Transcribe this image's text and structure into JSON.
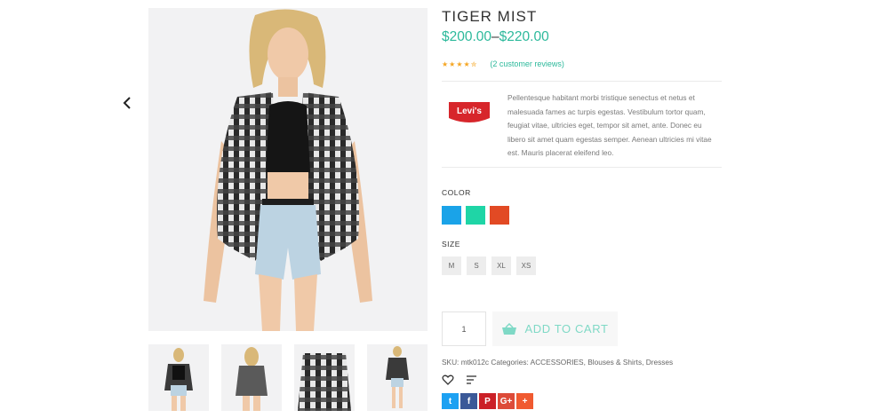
{
  "product": {
    "title": "TIGER MIST",
    "price_min": "$200.00",
    "price_sep": "–",
    "price_max": "$220.00",
    "rating": 4.5,
    "stars_text": "★★★★✮",
    "reviews_text": "(2 customer reviews)",
    "brand_logo_text": "Levi's",
    "description": "Pellentesque habitant morbi tristique senectus et netus et malesuada fames ac turpis egestas. Vestibulum tortor quam, feugiat vitae, ultricies eget, tempor sit amet, ante. Donec eu libero sit amet quam egestas semper. Aenean ultricies mi vitae est. Mauris placerat eleifend leo."
  },
  "color": {
    "label": "COLOR",
    "options": [
      {
        "name": "blue",
        "hex": "#1aa3e8"
      },
      {
        "name": "green",
        "hex": "#1fd5a6"
      },
      {
        "name": "red",
        "hex": "#e24a24"
      }
    ]
  },
  "size": {
    "label": "SIZE",
    "options": [
      "M",
      "S",
      "XL",
      "XS"
    ]
  },
  "cart": {
    "quantity": "1",
    "add_label": "ADD TO CART"
  },
  "meta": {
    "sku_label": "SKU:",
    "sku": "mtk012c",
    "categories_label": "Categories:",
    "categories": [
      "ACCESSORIES",
      "Blouses & Shirts",
      "Dresses"
    ]
  },
  "social": [
    {
      "name": "twitter",
      "glyph": "t",
      "color": "#1da1f2"
    },
    {
      "name": "facebook",
      "glyph": "f",
      "color": "#3b5998"
    },
    {
      "name": "pinterest",
      "glyph": "P",
      "color": "#cb2027"
    },
    {
      "name": "google-plus",
      "glyph": "G+",
      "color": "#dd4b39"
    },
    {
      "name": "more",
      "glyph": "+",
      "color": "#f05a30"
    }
  ],
  "colors": {
    "accent": "#2cb99b",
    "star": "#f5a623"
  }
}
